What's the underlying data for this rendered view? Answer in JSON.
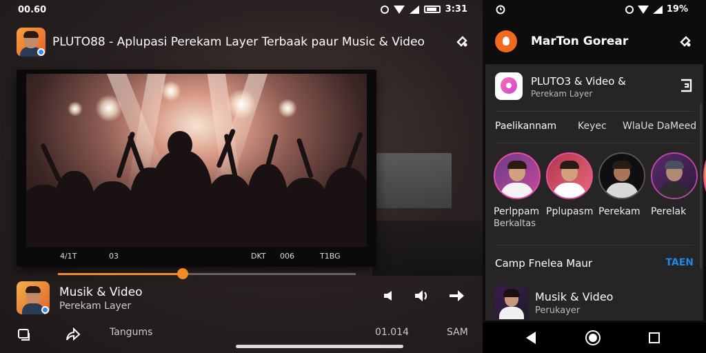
{
  "left_status": {
    "time": "00.60",
    "battery_text": "3:31"
  },
  "left_header": {
    "title": "PLUTO88 - Aplupasi Perekam Layer Terbaak paur Music & Video",
    "icon": "share-icon"
  },
  "video": {
    "times": [
      "4/1T",
      "03",
      "DKT",
      "006",
      "T1BG"
    ]
  },
  "progress": {
    "fraction": 0.42,
    "accent": "#f28a25"
  },
  "now_playing": {
    "title": "Musik & Video",
    "subtitle": "Perekam Layer"
  },
  "bottom_bar": {
    "label": "Tangums",
    "value": "01.014",
    "end": "SAM"
  },
  "right_status": {
    "battery_text": "19%"
  },
  "right_header": {
    "title": "MarTon Gorear",
    "accent": "#f06a1e"
  },
  "app": {
    "name": "PLUTO3 & Video &",
    "subtitle": "Perekam Layer"
  },
  "tabs": [
    "Paelikannam",
    "Keyec",
    "WlaUe DaMeed"
  ],
  "circles": [
    {
      "label": "Perlppam",
      "label2": "Berkaltas"
    },
    {
      "label": "Pplupasm",
      "label2": ""
    },
    {
      "label": "Perekam",
      "label2": ""
    },
    {
      "label": "Perelak",
      "label2": ""
    }
  ],
  "section": {
    "title": "Camp Fnelea Maur",
    "action": "TAEN",
    "action_color": "#1e88e5"
  },
  "list_item": {
    "title": "Musik & Video",
    "subtitle": "Perukayer"
  }
}
